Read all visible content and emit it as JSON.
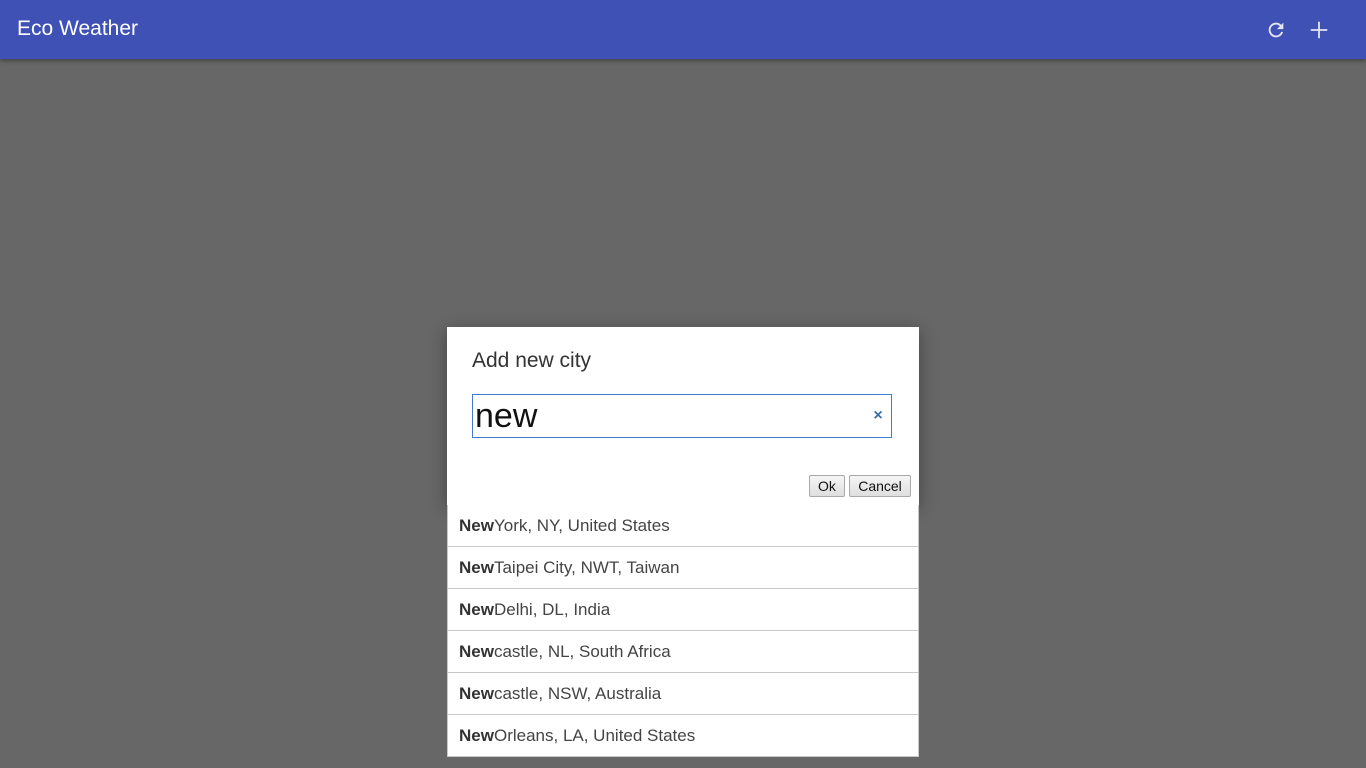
{
  "header": {
    "title": "Eco Weather",
    "refresh_icon": "refresh-icon",
    "add_icon": "plus-icon",
    "color": "#3f51b5"
  },
  "dialog": {
    "title": "Add new city",
    "input_value": "new",
    "clear_label": "×",
    "ok_label": "Ok",
    "cancel_label": "Cancel"
  },
  "suggestions": [
    {
      "match": "New",
      "rest": " York, NY, United States"
    },
    {
      "match": "New",
      "rest": " Taipei City, NWT, Taiwan"
    },
    {
      "match": "New",
      "rest": " Delhi, DL, India"
    },
    {
      "match": "New",
      "rest": "castle, NL, South Africa"
    },
    {
      "match": "New",
      "rest": "castle, NSW, Australia"
    },
    {
      "match": "New",
      "rest": " Orleans, LA, United States"
    }
  ]
}
